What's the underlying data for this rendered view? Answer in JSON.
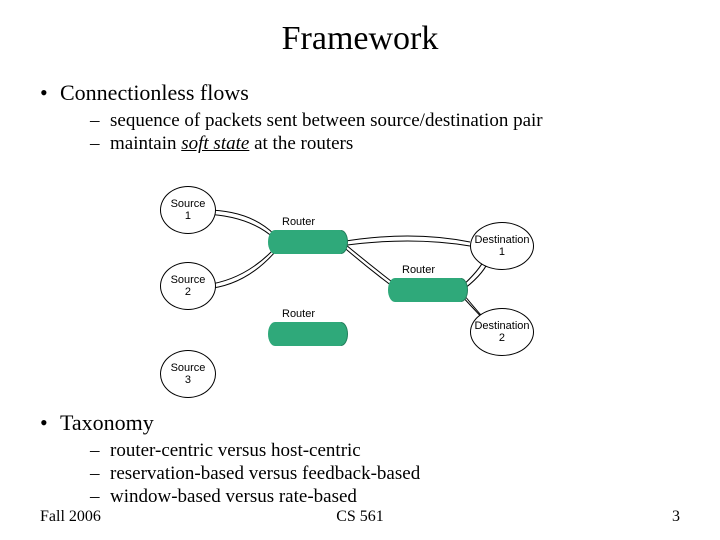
{
  "title": "Framework",
  "bullets": {
    "b1a": "Connectionless flows",
    "b2a": "sequence of packets sent between source/destination pair",
    "b2b_prefix": "maintain ",
    "b2b_soft": "soft state",
    "b2b_suffix": " at the routers",
    "b1b": "Taxonomy",
    "t1": "router-centric versus host-centric",
    "t2": "reservation-based versus feedback-based",
    "t3": "window-based versus rate-based"
  },
  "diagram": {
    "source1": "Source\n1",
    "source2": "Source\n2",
    "source3": "Source\n3",
    "dest1": "Destination\n1",
    "dest2": "Destination\n2",
    "router": "Router"
  },
  "footer": {
    "left": "Fall 2006",
    "center": "CS 561",
    "right": "3"
  }
}
